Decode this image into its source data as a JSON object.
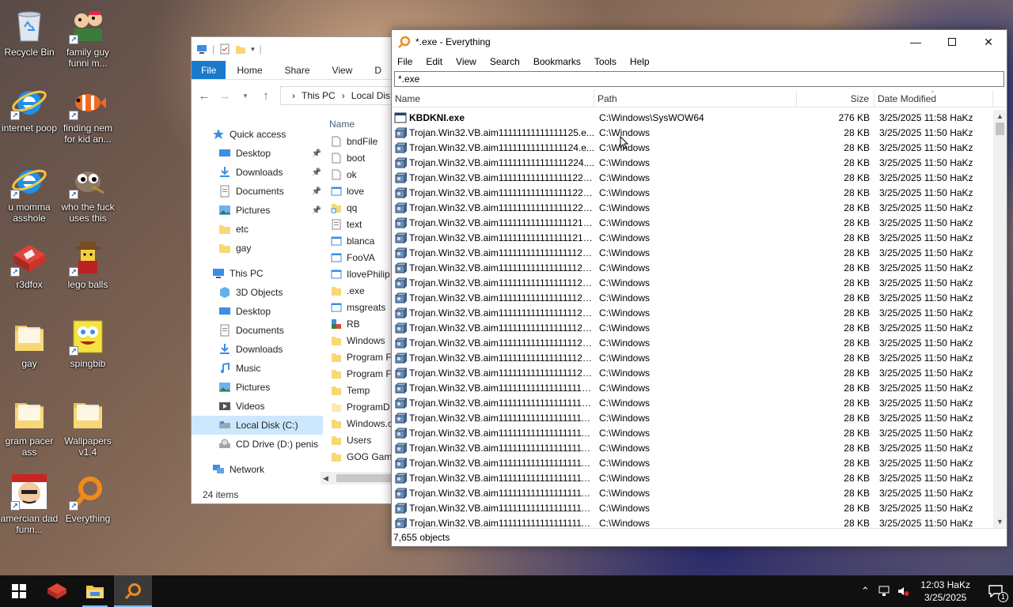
{
  "desktop": {
    "icons": [
      {
        "label": "Recycle Bin",
        "icon": "recycle-bin-icon"
      },
      {
        "label": "family guy funni m...",
        "icon": "family-guy-icon"
      },
      {
        "label": "internet poop",
        "icon": "internet-explorer-icon"
      },
      {
        "label": "finding nem for kid an...",
        "icon": "clownfish-icon"
      },
      {
        "label": "u momma asshole",
        "icon": "internet-explorer-icon"
      },
      {
        "label": "who the fuck uses this",
        "icon": "gimp-icon"
      },
      {
        "label": "r3dfox",
        "icon": "r3dfox-icon"
      },
      {
        "label": "lego balls",
        "icon": "lego-figure-icon"
      },
      {
        "label": "gay",
        "icon": "folder-icon"
      },
      {
        "label": "spingbib",
        "icon": "spongebob-icon"
      },
      {
        "label": "gram pacer ass",
        "icon": "folder-icon"
      },
      {
        "label": "Wallpapers v1.4",
        "icon": "folder-icon"
      },
      {
        "label": "amercian dad funn...",
        "icon": "american-dad-icon"
      },
      {
        "label": "Everything",
        "icon": "everything-icon"
      }
    ]
  },
  "explorer": {
    "ribbon_tabs": [
      "File",
      "Home",
      "Share",
      "View",
      "D"
    ],
    "breadcrumb": [
      "This PC",
      "Local Dis"
    ],
    "nav": {
      "quick_access": "Quick access",
      "pinned": [
        "Desktop",
        "Downloads",
        "Documents",
        "Pictures"
      ],
      "folders": [
        "etc",
        "gay"
      ],
      "this_pc": "This PC",
      "this_pc_items": [
        "3D Objects",
        "Desktop",
        "Documents",
        "Downloads",
        "Music",
        "Pictures",
        "Videos",
        "Local Disk (C:)",
        "CD Drive (D:) penis"
      ],
      "network": "Network"
    },
    "files_header": "Name",
    "files": [
      {
        "name": "bndFile",
        "kind": "file"
      },
      {
        "name": "boot",
        "kind": "file"
      },
      {
        "name": "ok",
        "kind": "file"
      },
      {
        "name": "love",
        "kind": "app"
      },
      {
        "name": "qq",
        "kind": "shortcut"
      },
      {
        "name": "text",
        "kind": "text"
      },
      {
        "name": "blanca",
        "kind": "app"
      },
      {
        "name": "FooVA",
        "kind": "app"
      },
      {
        "name": "IlovePhilip",
        "kind": "app"
      },
      {
        "name": ".exe",
        "kind": "folder"
      },
      {
        "name": "msgreats",
        "kind": "app"
      },
      {
        "name": "RB",
        "kind": "reg"
      },
      {
        "name": "Windows",
        "kind": "folder"
      },
      {
        "name": "Program F",
        "kind": "folder"
      },
      {
        "name": "Program F",
        "kind": "folder"
      },
      {
        "name": "Temp",
        "kind": "folder"
      },
      {
        "name": "ProgramD",
        "kind": "folder-light"
      },
      {
        "name": "Windows.c",
        "kind": "folder"
      },
      {
        "name": "Users",
        "kind": "folder"
      },
      {
        "name": "GOG Gam",
        "kind": "folder"
      }
    ],
    "status": "24 items"
  },
  "everything": {
    "title": "*.exe - Everything",
    "menu": [
      "File",
      "Edit",
      "View",
      "Search",
      "Bookmarks",
      "Tools",
      "Help"
    ],
    "search_value": "*.exe",
    "columns": {
      "name": "Name",
      "path": "Path",
      "size": "Size",
      "date": "Date Modified"
    },
    "rows": [
      {
        "name": "KBDKNI.exe",
        "bold": true,
        "path": "C:\\Windows\\SysWOW64",
        "size": "276 KB",
        "date": "3/25/2025 11:58 HaKz",
        "icon": "exe-window-icon"
      },
      {
        "name": "Trojan.Win32.VB.aim11111111111111125.e...",
        "path": "C:\\Windows",
        "size": "28 KB",
        "date": "3/25/2025 11:50 HaKz",
        "icon": "vb-exe-icon"
      },
      {
        "name": "Trojan.Win32.VB.aim11111111111111124.e...",
        "path": "C:\\Windows",
        "size": "28 KB",
        "date": "3/25/2025 11:50 HaKz",
        "icon": "vb-exe-icon"
      },
      {
        "name": "Trojan.Win32.VB.aim111111111111111224....",
        "path": "C:\\Windows",
        "size": "28 KB",
        "date": "3/25/2025 11:50 HaKz",
        "icon": "vb-exe-icon"
      },
      {
        "name": "Trojan.Win32.VB.aim1111111111111111223....",
        "path": "C:\\Windows",
        "size": "28 KB",
        "date": "3/25/2025 11:50 HaKz",
        "icon": "vb-exe-icon"
      },
      {
        "name": "Trojan.Win32.VB.aim1111111111111111222....",
        "path": "C:\\Windows",
        "size": "28 KB",
        "date": "3/25/2025 11:50 HaKz",
        "icon": "vb-exe-icon"
      },
      {
        "name": "Trojan.Win32.VB.aim1111111111111111221....",
        "path": "C:\\Windows",
        "size": "28 KB",
        "date": "3/25/2025 11:50 HaKz",
        "icon": "vb-exe-icon"
      },
      {
        "name": "Trojan.Win32.VB.aim1111111111111111214....",
        "path": "C:\\Windows",
        "size": "28 KB",
        "date": "3/25/2025 11:50 HaKz",
        "icon": "vb-exe-icon"
      },
      {
        "name": "Trojan.Win32.VB.aim1111111111111111213....",
        "path": "C:\\Windows",
        "size": "28 KB",
        "date": "3/25/2025 11:50 HaKz",
        "icon": "vb-exe-icon"
      },
      {
        "name": "Trojan.Win32.VB.aim1111111111111111125....",
        "path": "C:\\Windows",
        "size": "28 KB",
        "date": "3/25/2025 11:50 HaKz",
        "icon": "vb-exe-icon"
      },
      {
        "name": "Trojan.Win32.VB.aim1111111111111111124....",
        "path": "C:\\Windows",
        "size": "28 KB",
        "date": "3/25/2025 11:50 HaKz",
        "icon": "vb-exe-icon"
      },
      {
        "name": "Trojan.Win32.VB.aim11111111111111111224....",
        "path": "C:\\Windows",
        "size": "28 KB",
        "date": "3/25/2025 11:50 HaKz",
        "icon": "vb-exe-icon"
      },
      {
        "name": "Trojan.Win32.VB.aim11111111111111111223....",
        "path": "C:\\Windows",
        "size": "28 KB",
        "date": "3/25/2025 11:50 HaKz",
        "icon": "vb-exe-icon"
      },
      {
        "name": "Trojan.Win32.VB.aim11111111111111111222....",
        "path": "C:\\Windows",
        "size": "28 KB",
        "date": "3/25/2025 11:50 HaKz",
        "icon": "vb-exe-icon"
      },
      {
        "name": "Trojan.Win32.VB.aim11111111111111111221....",
        "path": "C:\\Windows",
        "size": "28 KB",
        "date": "3/25/2025 11:50 HaKz",
        "icon": "vb-exe-icon"
      },
      {
        "name": "Trojan.Win32.VB.aim11111111111111111215....",
        "path": "C:\\Windows",
        "size": "28 KB",
        "date": "3/25/2025 11:50 HaKz",
        "icon": "vb-exe-icon"
      },
      {
        "name": "Trojan.Win32.VB.aim11111111111111111214....",
        "path": "C:\\Windows",
        "size": "28 KB",
        "date": "3/25/2025 11:50 HaKz",
        "icon": "vb-exe-icon"
      },
      {
        "name": "Trojan.Win32.VB.aim11111111111111111213....",
        "path": "C:\\Windows",
        "size": "28 KB",
        "date": "3/25/2025 11:50 HaKz",
        "icon": "vb-exe-icon"
      },
      {
        "name": "Trojan.Win32.VB.aim11111111111111111125....",
        "path": "C:\\Windows",
        "size": "28 KB",
        "date": "3/25/2025 11:50 HaKz",
        "icon": "vb-exe-icon"
      },
      {
        "name": "Trojan.Win32.VB.aim11111111111111111124....",
        "path": "C:\\Windows",
        "size": "28 KB",
        "date": "3/25/2025 11:50 HaKz",
        "icon": "vb-exe-icon"
      },
      {
        "name": "Trojan.Win32.VB.aim111111111111111111122....",
        "path": "C:\\Windows",
        "size": "28 KB",
        "date": "3/25/2025 11:50 HaKz",
        "icon": "vb-exe-icon"
      },
      {
        "name": "Trojan.Win32.VB.aim111111111111111111122....",
        "path": "C:\\Windows",
        "size": "28 KB",
        "date": "3/25/2025 11:50 HaKz",
        "icon": "vb-exe-icon"
      },
      {
        "name": "Trojan.Win32.VB.aim111111111111111111122....",
        "path": "C:\\Windows",
        "size": "28 KB",
        "date": "3/25/2025 11:50 HaKz",
        "icon": "vb-exe-icon"
      },
      {
        "name": "Trojan.Win32.VB.aim111111111111111111122....",
        "path": "C:\\Windows",
        "size": "28 KB",
        "date": "3/25/2025 11:50 HaKz",
        "icon": "vb-exe-icon"
      },
      {
        "name": "Trojan.Win32.VB.aim111111111111111111121....",
        "path": "C:\\Windows",
        "size": "28 KB",
        "date": "3/25/2025 11:50 HaKz",
        "icon": "vb-exe-icon"
      },
      {
        "name": "Trojan.Win32.VB.aim111111111111111111121....",
        "path": "C:\\Windows",
        "size": "28 KB",
        "date": "3/25/2025 11:50 HaKz",
        "icon": "vb-exe-icon"
      },
      {
        "name": "Trojan.Win32.VB.aim111111111111111111121....",
        "path": "C:\\Windows",
        "size": "28 KB",
        "date": "3/25/2025 11:50 HaKz",
        "icon": "vb-exe-icon"
      },
      {
        "name": "Trojan.Win32.VB.aim111111111111111111112....",
        "path": "C:\\Windows",
        "size": "28 KB",
        "date": "3/25/2025 11:50 HaKz",
        "icon": "vb-exe-icon"
      }
    ],
    "status": "7,655 objects"
  },
  "taskbar": {
    "pinned": [
      "windows-start-icon",
      "r3dfox-icon",
      "file-explorer-icon",
      "everything-icon"
    ],
    "clock_time": "12:03 HaKz",
    "clock_date": "3/25/2025",
    "notification_count": "1"
  },
  "colors": {
    "ribbon_file": "#1979ca",
    "selection": "#cce8ff",
    "taskbar": "#101010",
    "everything_orange": "#f08a1c"
  }
}
